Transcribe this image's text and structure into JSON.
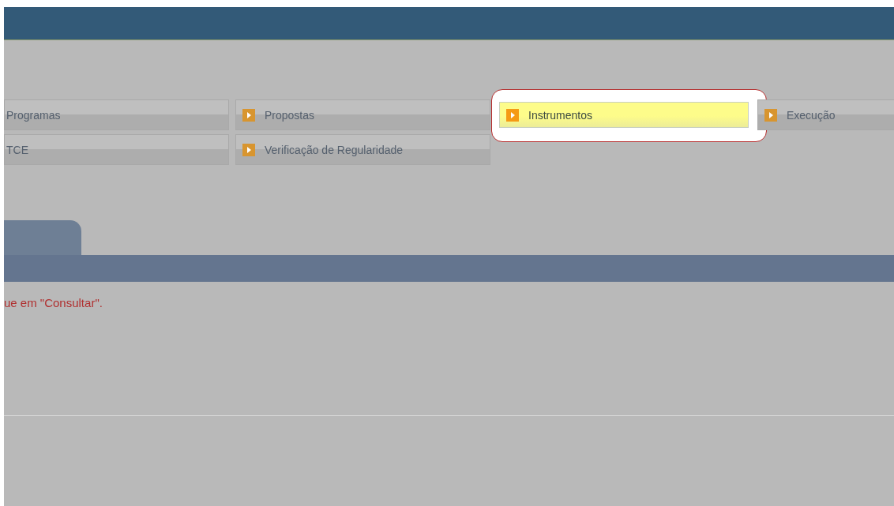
{
  "menu": {
    "rows": [
      [
        {
          "label": "Programas",
          "has_icon": false,
          "selected": false
        },
        {
          "label": "Propostas",
          "has_icon": true,
          "selected": false
        },
        {
          "label": "Instrumentos",
          "has_icon": true,
          "selected": true
        },
        {
          "label": "Execução",
          "has_icon": true,
          "selected": false
        }
      ],
      [
        {
          "label": "TCE",
          "has_icon": false,
          "selected": false
        },
        {
          "label": "Verificação de Regularidade",
          "has_icon": true,
          "selected": false
        }
      ]
    ]
  },
  "message": "ue em \"Consultar\"."
}
